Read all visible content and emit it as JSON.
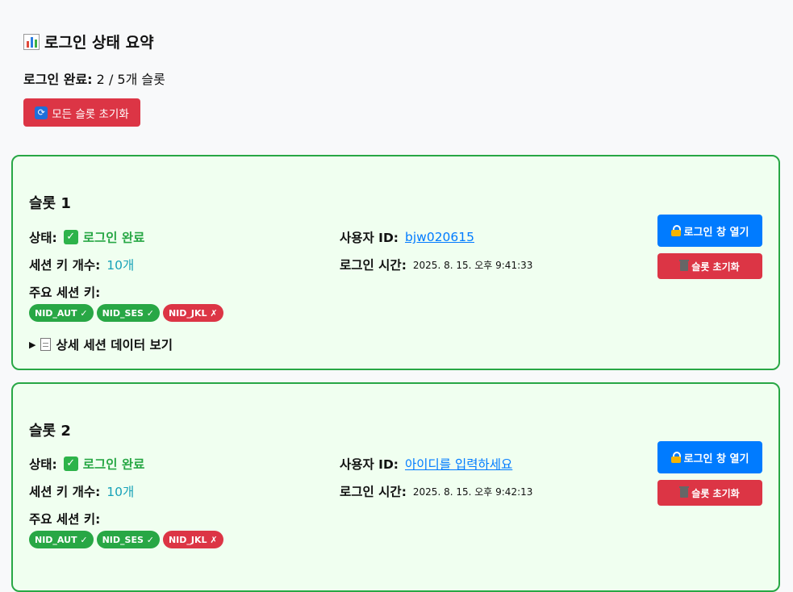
{
  "summary": {
    "title": "로그인 상태 요약",
    "login_label": "로그인 완료:",
    "login_value": "2 / 5개 슬롯",
    "reset_all_label": "모든 슬롯 초기화"
  },
  "labels": {
    "status": "상태:",
    "session_count": "세션 키 개수:",
    "main_keys": "주요 세션 키:",
    "user_id": "사용자 ID:",
    "login_time": "로그인 시간:",
    "details": "상세 세션 데이터 보기",
    "open_login": "로그인 창 열기",
    "reset_slot": "슬롯 초기화"
  },
  "slots": [
    {
      "title": "슬롯 1",
      "status": "로그인 완료",
      "session_count": "10개",
      "user_id": "bjw020615",
      "login_time": "2025. 8. 15. 오후 9:41:33",
      "keys": [
        {
          "label": "NID_AUT ✓",
          "ok": true
        },
        {
          "label": "NID_SES ✓",
          "ok": true
        },
        {
          "label": "NID_JKL ✗",
          "ok": false
        }
      ]
    },
    {
      "title": "슬롯 2",
      "status": "로그인 완료",
      "session_count": "10개",
      "user_id": "아이디를 입력하세요",
      "login_time": "2025. 8. 15. 오후 9:42:13",
      "keys": [
        {
          "label": "NID_AUT ✓",
          "ok": true
        },
        {
          "label": "NID_SES ✓",
          "ok": true
        },
        {
          "label": "NID_JKL ✗",
          "ok": false
        }
      ]
    }
  ],
  "colors": {
    "success": "#28a745",
    "danger": "#dc3545",
    "primary": "#007bff",
    "info": "#17a2b8",
    "slot_bg": "#f0fff0"
  },
  "icons": {
    "summary": "bar-chart-icon",
    "reset_all": "refresh-icon",
    "status": "check-icon",
    "details": "document-icon",
    "open_login": "lock-icon",
    "reset_slot": "trash-icon"
  }
}
